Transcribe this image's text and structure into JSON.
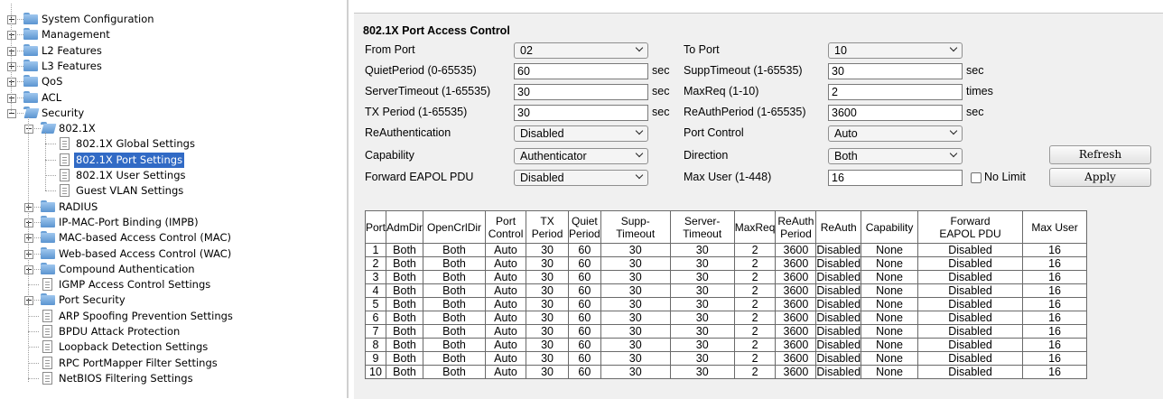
{
  "tree": {
    "items": [
      {
        "label": "System Configuration",
        "expander": "plus",
        "icon": "folder"
      },
      {
        "label": "Management",
        "expander": "plus",
        "icon": "folder"
      },
      {
        "label": "L2 Features",
        "expander": "plus",
        "icon": "folder"
      },
      {
        "label": "L3 Features",
        "expander": "plus",
        "icon": "folder"
      },
      {
        "label": "QoS",
        "expander": "plus",
        "icon": "folder"
      },
      {
        "label": "ACL",
        "expander": "plus",
        "icon": "folder"
      },
      {
        "label": "Security",
        "expander": "minus",
        "icon": "folder-open"
      },
      {
        "label": "802.1X",
        "expander": "minus",
        "icon": "folder-open"
      },
      {
        "label": "802.1X Global Settings",
        "icon": "document"
      },
      {
        "label": "802.1X Port Settings",
        "icon": "document",
        "selected": true
      },
      {
        "label": "802.1X User Settings",
        "icon": "document"
      },
      {
        "label": "Guest VLAN Settings",
        "icon": "document"
      },
      {
        "label": "RADIUS",
        "expander": "plus",
        "icon": "folder"
      },
      {
        "label": "IP-MAC-Port Binding (IMPB)",
        "expander": "plus",
        "icon": "folder"
      },
      {
        "label": "MAC-based Access Control (MAC)",
        "expander": "plus",
        "icon": "folder"
      },
      {
        "label": "Web-based Access Control (WAC)",
        "expander": "plus",
        "icon": "folder"
      },
      {
        "label": "Compound Authentication",
        "expander": "plus",
        "icon": "folder"
      },
      {
        "label": "IGMP Access Control Settings",
        "icon": "document"
      },
      {
        "label": "Port Security",
        "expander": "plus",
        "icon": "folder"
      },
      {
        "label": "ARP Spoofing Prevention Settings",
        "icon": "document"
      },
      {
        "label": "BPDU Attack Protection",
        "icon": "document"
      },
      {
        "label": "Loopback Detection Settings",
        "icon": "document"
      },
      {
        "label": "RPC PortMapper Filter Settings",
        "icon": "document"
      },
      {
        "label": "NetBIOS Filtering Settings",
        "icon": "document"
      }
    ]
  },
  "form": {
    "title": "802.1X Port Access Control",
    "from_port_label": "From Port",
    "from_port_value": "02",
    "to_port_label": "To Port",
    "to_port_value": "10",
    "quiet_period_label": "QuietPeriod (0-65535)",
    "quiet_period_value": "60",
    "supp_timeout_label": "SuppTimeout (1-65535)",
    "supp_timeout_value": "30",
    "server_timeout_label": "ServerTimeout (1-65535)",
    "server_timeout_value": "30",
    "max_req_label": "MaxReq (1-10)",
    "max_req_value": "2",
    "tx_period_label": "TX Period (1-65535)",
    "tx_period_value": "30",
    "reauth_period_label": "ReAuthPeriod (1-65535)",
    "reauth_period_value": "3600",
    "unit_sec": "sec",
    "unit_times": "times",
    "reauthentication_label": "ReAuthentication",
    "reauthentication_value": "Disabled",
    "port_control_label": "Port Control",
    "port_control_value": "Auto",
    "capability_label": "Capability",
    "capability_value": "Authenticator",
    "direction_label": "Direction",
    "direction_value": "Both",
    "forward_eapol_label": "Forward EAPOL PDU",
    "forward_eapol_value": "Disabled",
    "max_user_label": "Max User (1-448)",
    "max_user_value": "16",
    "no_limit_label": "No Limit",
    "no_limit_checked": false,
    "refresh_label": "Refresh",
    "apply_label": "Apply"
  },
  "table": {
    "headers": [
      [
        "Port"
      ],
      [
        "AdmDir"
      ],
      [
        "OpenCrlDir"
      ],
      [
        "Port",
        "Control"
      ],
      [
        "TX",
        "Period"
      ],
      [
        "Quiet",
        "Period"
      ],
      [
        "Supp-",
        "Timeout"
      ],
      [
        "Server-",
        "Timeout"
      ],
      [
        "MaxReq"
      ],
      [
        "ReAuth",
        "Period"
      ],
      [
        "ReAuth"
      ],
      [
        "Capability"
      ],
      [
        "Forward",
        "EAPOL PDU"
      ],
      [
        "Max User"
      ]
    ],
    "rows": [
      [
        "1",
        "Both",
        "Both",
        "Auto",
        "30",
        "60",
        "30",
        "30",
        "2",
        "3600",
        "Disabled",
        "None",
        "Disabled",
        "16"
      ],
      [
        "2",
        "Both",
        "Both",
        "Auto",
        "30",
        "60",
        "30",
        "30",
        "2",
        "3600",
        "Disabled",
        "None",
        "Disabled",
        "16"
      ],
      [
        "3",
        "Both",
        "Both",
        "Auto",
        "30",
        "60",
        "30",
        "30",
        "2",
        "3600",
        "Disabled",
        "None",
        "Disabled",
        "16"
      ],
      [
        "4",
        "Both",
        "Both",
        "Auto",
        "30",
        "60",
        "30",
        "30",
        "2",
        "3600",
        "Disabled",
        "None",
        "Disabled",
        "16"
      ],
      [
        "5",
        "Both",
        "Both",
        "Auto",
        "30",
        "60",
        "30",
        "30",
        "2",
        "3600",
        "Disabled",
        "None",
        "Disabled",
        "16"
      ],
      [
        "6",
        "Both",
        "Both",
        "Auto",
        "30",
        "60",
        "30",
        "30",
        "2",
        "3600",
        "Disabled",
        "None",
        "Disabled",
        "16"
      ],
      [
        "7",
        "Both",
        "Both",
        "Auto",
        "30",
        "60",
        "30",
        "30",
        "2",
        "3600",
        "Disabled",
        "None",
        "Disabled",
        "16"
      ],
      [
        "8",
        "Both",
        "Both",
        "Auto",
        "30",
        "60",
        "30",
        "30",
        "2",
        "3600",
        "Disabled",
        "None",
        "Disabled",
        "16"
      ],
      [
        "9",
        "Both",
        "Both",
        "Auto",
        "30",
        "60",
        "30",
        "30",
        "2",
        "3600",
        "Disabled",
        "None",
        "Disabled",
        "16"
      ],
      [
        "10",
        "Both",
        "Both",
        "Auto",
        "30",
        "60",
        "30",
        "30",
        "2",
        "3600",
        "Disabled",
        "None",
        "Disabled",
        "16"
      ]
    ]
  }
}
